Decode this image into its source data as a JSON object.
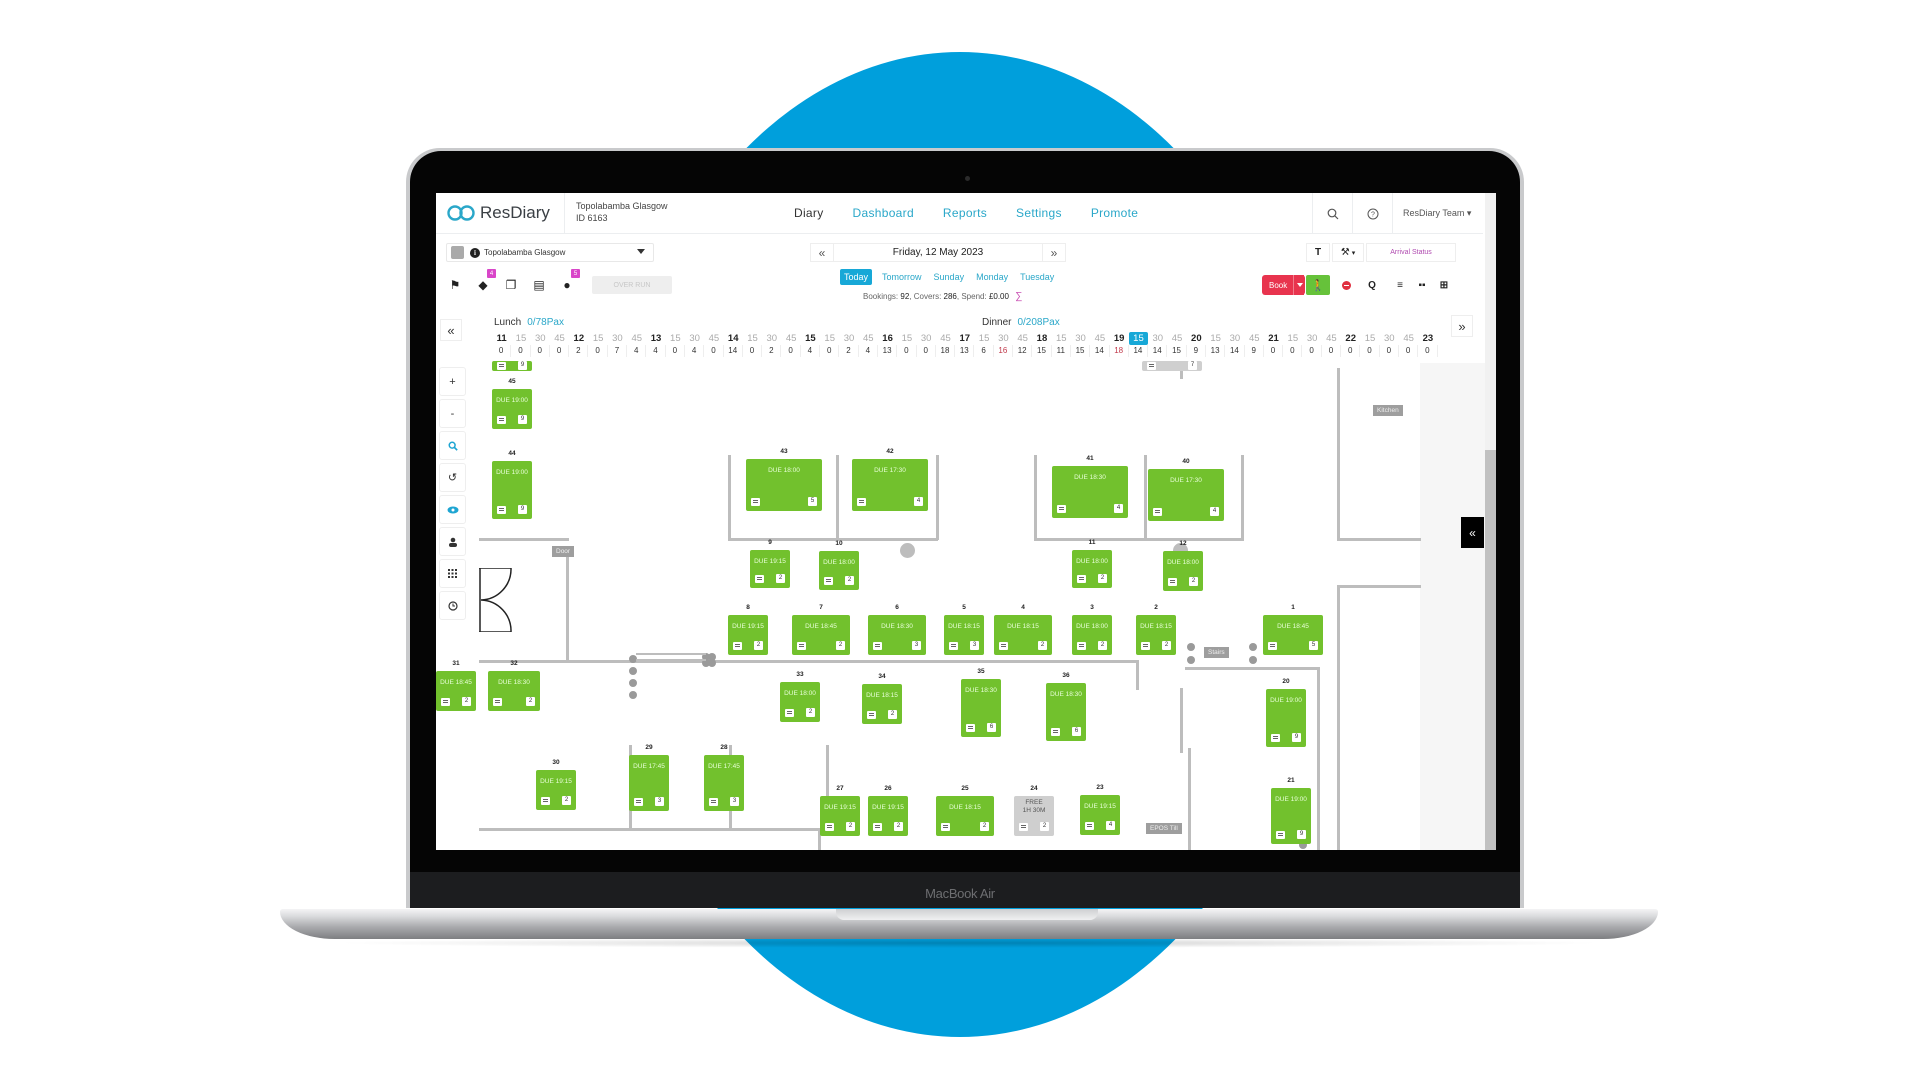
{
  "device": {
    "label": "MacBook Air"
  },
  "colors": {
    "brand_blue": "#009fdc",
    "table_green": "#72c12d",
    "book_red": "#e8344e",
    "walkin_green": "#66c23a",
    "link_blue": "#2aa7c9"
  },
  "nav": {
    "brand": "ResDiary",
    "venue_name": "Topolabamba Glasgow",
    "venue_id": "ID 6163",
    "links": [
      {
        "label": "Diary",
        "active": true
      },
      {
        "label": "Dashboard",
        "active": false
      },
      {
        "label": "Reports",
        "active": false
      },
      {
        "label": "Settings",
        "active": false
      },
      {
        "label": "Promote",
        "active": false
      }
    ],
    "search_icon": "search-icon",
    "help_icon": "help-icon",
    "user_menu": "ResDiary Team"
  },
  "toolbar": {
    "venue_select": "Topolabamba Glasgow",
    "icons": [
      {
        "name": "flag-icon",
        "glyph": "⚑",
        "badge": null
      },
      {
        "name": "tag-icon",
        "glyph": "🏷",
        "badge": "4"
      },
      {
        "name": "copy-icon",
        "glyph": "❐",
        "badge": null
      },
      {
        "name": "list-icon",
        "glyph": "☰",
        "badge": null
      },
      {
        "name": "user-icon",
        "glyph": "👤",
        "badge": "5"
      }
    ],
    "overrun_label": "OVER RUN",
    "date": "Friday, 12 May 2023",
    "prev_label": "«",
    "next_label": "»",
    "day_tabs": [
      {
        "label": "Today",
        "active": true
      },
      {
        "label": "Tomorrow",
        "active": false
      },
      {
        "label": "Sunday",
        "active": false
      },
      {
        "label": "Monday",
        "active": false
      },
      {
        "label": "Tuesday",
        "active": false
      }
    ],
    "stats": {
      "bookings_label": "Bookings:",
      "bookings": "92",
      "covers_label": "Covers:",
      "covers": "286",
      "spend_label": "Spend:",
      "spend": "£0.00",
      "sigma": "∑"
    },
    "arrival_status_label": "Arrival Status",
    "book_label": "Book",
    "text_tool": "T",
    "wrench_tool": "🔧",
    "q_label": "Q"
  },
  "timeline": {
    "lunch": {
      "label": "Lunch",
      "pax": "0/78Pax"
    },
    "dinner": {
      "label": "Dinner",
      "pax": "0/208Pax"
    },
    "slots": [
      {
        "t": "11",
        "c": "0",
        "h": true
      },
      {
        "t": "15",
        "c": "0"
      },
      {
        "t": "30",
        "c": "0"
      },
      {
        "t": "45",
        "c": "0"
      },
      {
        "t": "12",
        "c": "2",
        "h": true
      },
      {
        "t": "15",
        "c": "0"
      },
      {
        "t": "30",
        "c": "7"
      },
      {
        "t": "45",
        "c": "4"
      },
      {
        "t": "13",
        "c": "4",
        "h": true
      },
      {
        "t": "15",
        "c": "0"
      },
      {
        "t": "30",
        "c": "4"
      },
      {
        "t": "45",
        "c": "0"
      },
      {
        "t": "14",
        "c": "14",
        "h": true
      },
      {
        "t": "15",
        "c": "0"
      },
      {
        "t": "30",
        "c": "2"
      },
      {
        "t": "45",
        "c": "0"
      },
      {
        "t": "15",
        "c": "4",
        "h": true
      },
      {
        "t": "15",
        "c": "0"
      },
      {
        "t": "30",
        "c": "2"
      },
      {
        "t": "45",
        "c": "4"
      },
      {
        "t": "16",
        "c": "13",
        "h": true
      },
      {
        "t": "15",
        "c": "0"
      },
      {
        "t": "30",
        "c": "0"
      },
      {
        "t": "45",
        "c": "18"
      },
      {
        "t": "17",
        "c": "13",
        "h": true
      },
      {
        "t": "15",
        "c": "6"
      },
      {
        "t": "30",
        "c": "16",
        "alert": true
      },
      {
        "t": "45",
        "c": "12"
      },
      {
        "t": "18",
        "c": "15",
        "h": true
      },
      {
        "t": "15",
        "c": "11"
      },
      {
        "t": "30",
        "c": "15"
      },
      {
        "t": "45",
        "c": "14"
      },
      {
        "t": "19",
        "c": "18",
        "h": true,
        "alert": true
      },
      {
        "t": "15",
        "c": "14",
        "current": true
      },
      {
        "t": "30",
        "c": "14"
      },
      {
        "t": "45",
        "c": "15"
      },
      {
        "t": "20",
        "c": "9",
        "h": true
      },
      {
        "t": "15",
        "c": "13"
      },
      {
        "t": "30",
        "c": "14"
      },
      {
        "t": "45",
        "c": "9"
      },
      {
        "t": "21",
        "c": "0",
        "h": true
      },
      {
        "t": "15",
        "c": "0"
      },
      {
        "t": "30",
        "c": "0"
      },
      {
        "t": "45",
        "c": "0"
      },
      {
        "t": "22",
        "c": "0",
        "h": true
      },
      {
        "t": "15",
        "c": "0"
      },
      {
        "t": "30",
        "c": "0"
      },
      {
        "t": "45",
        "c": "0"
      },
      {
        "t": "23",
        "c": "0",
        "h": true
      }
    ]
  },
  "side_tools": [
    {
      "name": "zoom-in-button",
      "glyph": "+"
    },
    {
      "name": "zoom-out-button",
      "glyph": "-"
    },
    {
      "name": "search-button",
      "glyph": "🔍"
    },
    {
      "name": "undo-button",
      "glyph": "↺"
    },
    {
      "name": "view-button",
      "glyph": "👁"
    },
    {
      "name": "person-button",
      "glyph": "👤"
    },
    {
      "name": "grid-button",
      "glyph": "⁞⁞"
    },
    {
      "name": "clock-button",
      "glyph": "◷"
    }
  ],
  "floor_labels": {
    "door": "Door",
    "stairs": "Stairs",
    "kitchen": "Kitchen",
    "epos": "EPOS Till"
  },
  "tables": [
    {
      "num": "45",
      "due": "DUE 19:00",
      "covers": "9"
    },
    {
      "num": "44",
      "due": "DUE 19:00",
      "covers": "9"
    },
    {
      "num": "43",
      "due": "DUE 18:00",
      "covers": "5"
    },
    {
      "num": "42",
      "due": "DUE 17:30",
      "covers": "4"
    },
    {
      "num": "41",
      "due": "DUE 18:30",
      "covers": "4"
    },
    {
      "num": "40",
      "due": "DUE 17:30",
      "covers": "4"
    },
    {
      "num": "9",
      "due": "DUE 19:15",
      "covers": "2"
    },
    {
      "num": "10",
      "due": "DUE 18:00",
      "covers": "2"
    },
    {
      "num": "11",
      "due": "DUE 18:00",
      "covers": "2"
    },
    {
      "num": "12",
      "due": "DUE 18:00",
      "covers": "2"
    },
    {
      "num": "8",
      "due": "DUE 19:15",
      "covers": "2"
    },
    {
      "num": "7",
      "due": "DUE 18:45",
      "covers": "2"
    },
    {
      "num": "6",
      "due": "DUE 18:30",
      "covers": "3"
    },
    {
      "num": "5",
      "due": "DUE 18:15",
      "covers": "3"
    },
    {
      "num": "4",
      "due": "DUE 18:15",
      "covers": "2"
    },
    {
      "num": "3",
      "due": "DUE 18:00",
      "covers": "2"
    },
    {
      "num": "2",
      "due": "DUE 18:15",
      "covers": "2"
    },
    {
      "num": "1",
      "due": "DUE 18:45",
      "covers": "5"
    },
    {
      "num": "31",
      "due": "DUE 18:45",
      "covers": "2"
    },
    {
      "num": "32",
      "due": "DUE 18:30",
      "covers": "2"
    },
    {
      "num": "33",
      "due": "DUE 18:00",
      "covers": "2"
    },
    {
      "num": "34",
      "due": "DUE 18:15",
      "covers": "2"
    },
    {
      "num": "35",
      "due": "DUE 18:30",
      "covers": "6"
    },
    {
      "num": "36",
      "due": "DUE 18:30",
      "covers": "6"
    },
    {
      "num": "20",
      "due": "DUE 19:00",
      "covers": "9"
    },
    {
      "num": "30",
      "due": "DUE 19:15",
      "covers": "2"
    },
    {
      "num": "29",
      "due": "DUE 17:45",
      "covers": "3"
    },
    {
      "num": "28",
      "due": "DUE 17:45",
      "covers": "3"
    },
    {
      "num": "27",
      "due": "DUE 19:15",
      "covers": "2"
    },
    {
      "num": "26",
      "due": "DUE 19:15",
      "covers": "2"
    },
    {
      "num": "25",
      "due": "DUE 18:15",
      "covers": "2"
    },
    {
      "num": "24",
      "due": "FREE\n1H 30M",
      "covers": "2",
      "free": true
    },
    {
      "num": "23",
      "due": "DUE 19:15",
      "covers": "4"
    },
    {
      "num": "21",
      "due": "DUE 19:00",
      "covers": "9"
    },
    {
      "num": "",
      "due": "",
      "covers": "9"
    },
    {
      "num": "",
      "due": "",
      "covers": "7",
      "free": true
    }
  ]
}
